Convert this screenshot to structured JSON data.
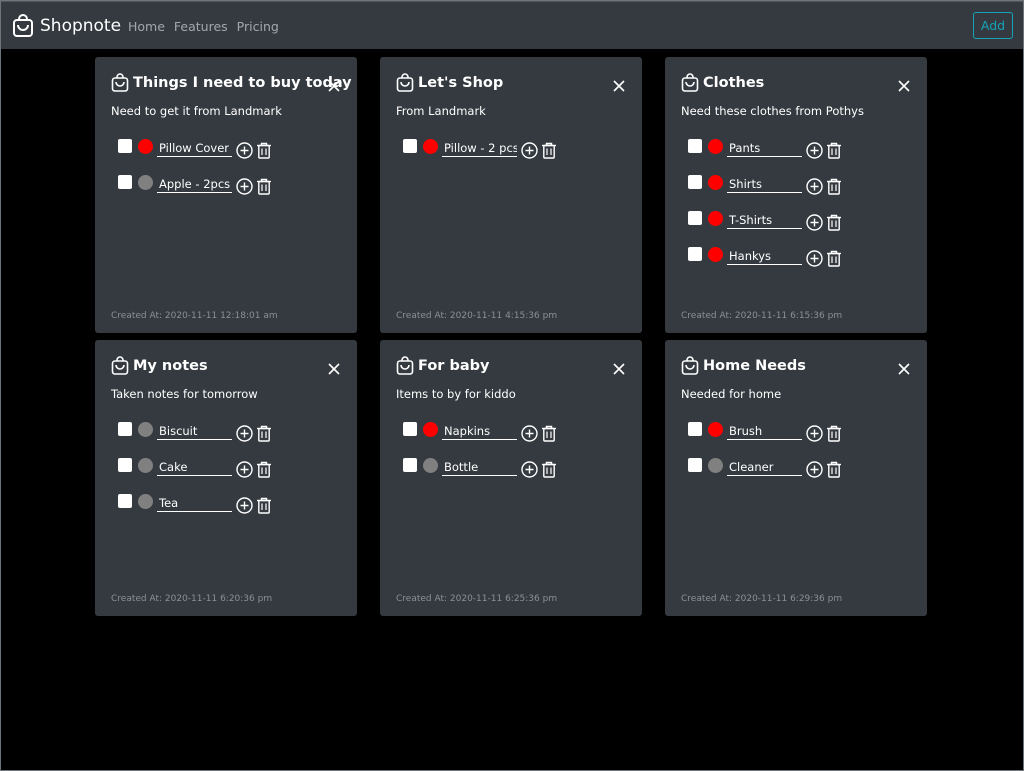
{
  "navbar": {
    "brand": "Shopnote",
    "links": [
      "Home",
      "Features",
      "Pricing"
    ],
    "add_label": "Add"
  },
  "colors": {
    "red": "#ff0000",
    "gray": "#808080",
    "accent": "#17a2b8"
  },
  "cards": [
    {
      "title": "Things I need to buy today",
      "description": "Need to get it from Landmark",
      "items": [
        {
          "text": "Pillow Cover",
          "dot": "red"
        },
        {
          "text": "Apple - 2pcs",
          "dot": "gray"
        }
      ],
      "created": "Created At: 2020-11-11 12:18:01 am"
    },
    {
      "title": "Let's Shop",
      "description": "From Landmark",
      "items": [
        {
          "text": "Pillow - 2 pcs",
          "dot": "red"
        }
      ],
      "created": "Created At: 2020-11-11 4:15:36 pm"
    },
    {
      "title": "Clothes",
      "description": "Need these clothes from Pothys",
      "items": [
        {
          "text": "Pants",
          "dot": "red"
        },
        {
          "text": "Shirts",
          "dot": "red"
        },
        {
          "text": "T-Shirts",
          "dot": "red"
        },
        {
          "text": "Hankys",
          "dot": "red"
        }
      ],
      "created": "Created At: 2020-11-11 6:15:36 pm"
    },
    {
      "title": "My notes",
      "description": "Taken notes for tomorrow",
      "items": [
        {
          "text": "Biscuit",
          "dot": "gray"
        },
        {
          "text": "Cake",
          "dot": "gray"
        },
        {
          "text": "Tea",
          "dot": "gray"
        }
      ],
      "created": "Created At: 2020-11-11 6:20:36 pm"
    },
    {
      "title": "For baby",
      "description": "Items to by for kiddo",
      "items": [
        {
          "text": "Napkins",
          "dot": "red"
        },
        {
          "text": "Bottle",
          "dot": "gray"
        }
      ],
      "created": "Created At: 2020-11-11 6:25:36 pm"
    },
    {
      "title": "Home Needs",
      "description": "Needed for home",
      "items": [
        {
          "text": "Brush",
          "dot": "red"
        },
        {
          "text": "Cleaner",
          "dot": "gray"
        }
      ],
      "created": "Created At: 2020-11-11 6:29:36 pm"
    }
  ]
}
